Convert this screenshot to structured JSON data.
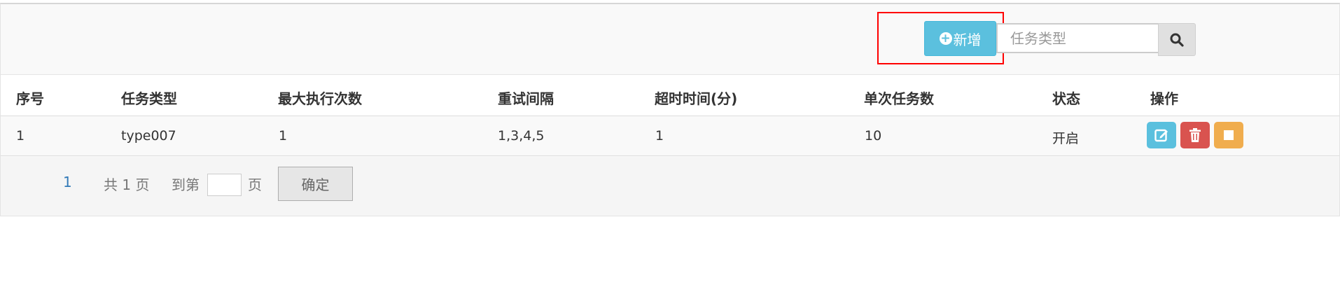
{
  "toolbar": {
    "add_label": "新增",
    "search_placeholder": "任务类型"
  },
  "table": {
    "headers": [
      "序号",
      "任务类型",
      "最大执行次数",
      "重试间隔",
      "超时时间(分)",
      "单次任务数",
      "状态",
      "操作"
    ],
    "rows": [
      {
        "index": "1",
        "type": "type007",
        "max_exec": "1",
        "retry_interval": "1,3,4,5",
        "timeout": "1",
        "batch": "10",
        "status": "开启"
      }
    ]
  },
  "pagination": {
    "current_page": "1",
    "total_label": "共 1 页",
    "goto_label": "到第",
    "page_suffix": "页",
    "confirm_label": "确定"
  },
  "colors": {
    "info": "#5bc0de",
    "danger": "#d9534f",
    "warning": "#f0ad4e",
    "highlight": "#ff0000"
  },
  "icons": [
    "plus-circle-icon",
    "search-icon",
    "edit-icon",
    "trash-icon",
    "stop-icon"
  ]
}
